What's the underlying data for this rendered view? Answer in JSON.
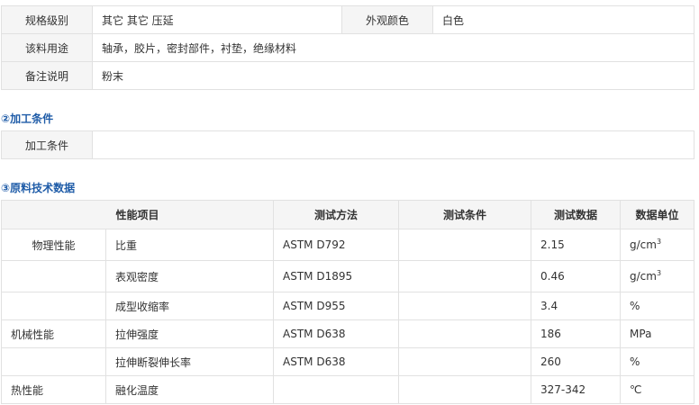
{
  "basic_info": {
    "spec_label": "规格级别",
    "spec_value": "其它 其它 压延",
    "appearance_label": "外观颜色",
    "appearance_value": "白色",
    "usage_label": "该料用途",
    "usage_value": "轴承，胶片，密封部件，衬垫，绝缘材料",
    "notes_label": "备注说明",
    "notes_value": "粉末"
  },
  "processing": {
    "title": "②加工条件",
    "label": "加工条件",
    "value": ""
  },
  "tech_data": {
    "title": "③原料技术数据",
    "headers": {
      "property": "性能项目",
      "method": "测试方法",
      "condition": "测试条件",
      "data": "测试数据",
      "unit": "数据单位"
    },
    "rows": [
      {
        "category": "物理性能",
        "item": "比重",
        "method": "ASTM D792",
        "condition": "",
        "value": "2.15",
        "unit": "g/cm",
        "unit_sup": "3"
      },
      {
        "category": "",
        "item": "表观密度",
        "method": "ASTM D1895",
        "condition": "",
        "value": "0.46",
        "unit": "g/cm",
        "unit_sup": "3"
      },
      {
        "category": "",
        "item": "成型收缩率",
        "method": "ASTM D955",
        "condition": "",
        "value": "3.4",
        "unit": "%",
        "unit_sup": ""
      },
      {
        "category": "机械性能",
        "item": "拉伸强度",
        "method": "ASTM D638",
        "condition": "",
        "value": "186",
        "unit": "MPa",
        "unit_sup": ""
      },
      {
        "category": "",
        "item": "拉伸断裂伸长率",
        "method": "ASTM D638",
        "condition": "",
        "value": "260",
        "unit": "%",
        "unit_sup": ""
      },
      {
        "category": "热性能",
        "item": "融化温度",
        "method": "",
        "condition": "",
        "value": "327-342",
        "unit": "℃",
        "unit_sup": ""
      }
    ]
  }
}
